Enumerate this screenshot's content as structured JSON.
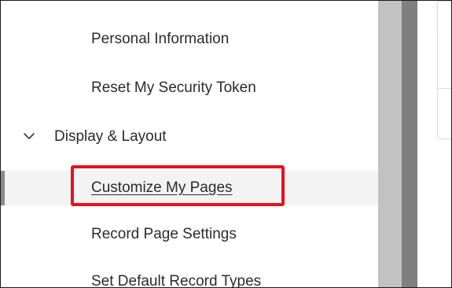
{
  "nav": {
    "items_top": [
      {
        "label": "Personal Information"
      },
      {
        "label": "Reset My Security Token"
      }
    ],
    "section": {
      "label": "Display & Layout",
      "icon": "chevron-down-icon",
      "expanded": true
    },
    "section_items": [
      {
        "label": "Customize My Pages",
        "selected": true,
        "highlighted": true
      },
      {
        "label": "Record Page Settings",
        "selected": false
      },
      {
        "label": "Set Default Record Types",
        "selected": false
      }
    ]
  },
  "colors": {
    "highlight": "#e8111c",
    "selected_bg": "#f3f3f3",
    "selected_indicator": "#8a8a8a",
    "text": "#2b2b2b",
    "scrollbar": "#c2c2c2",
    "divider": "#7f7f7f"
  }
}
